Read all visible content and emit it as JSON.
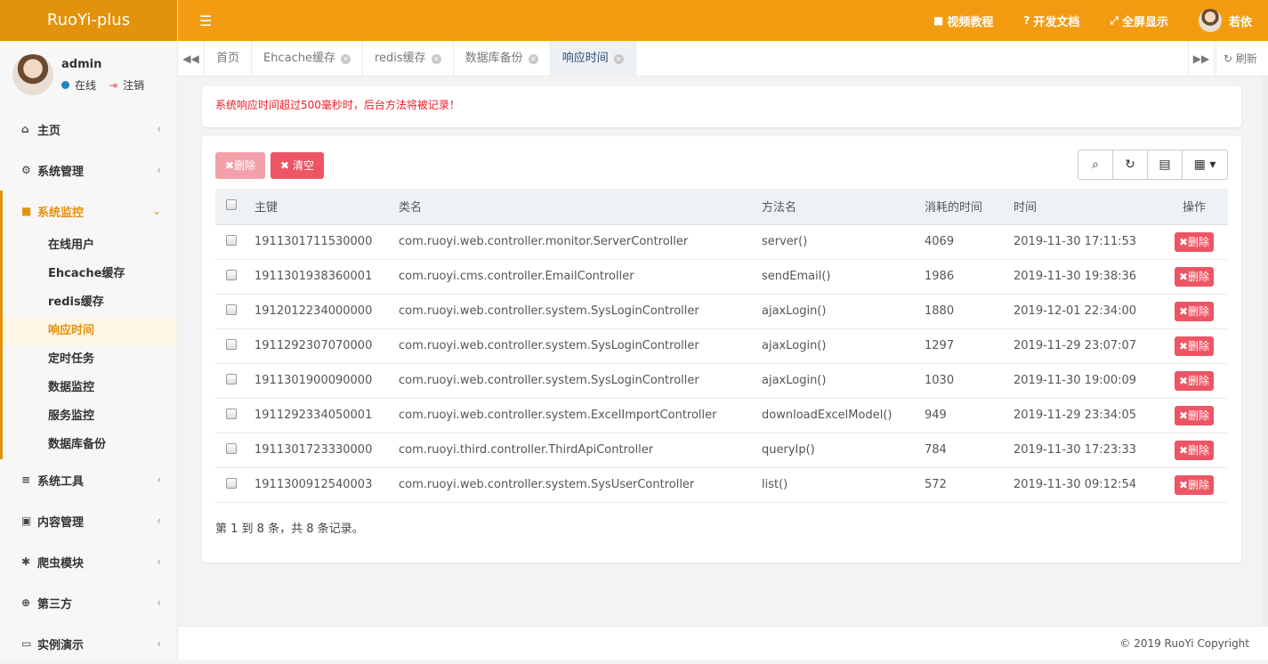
{
  "app": {
    "title": "RuoYi-plus"
  },
  "user": {
    "name": "admin",
    "status": "在线",
    "logout": "注销",
    "display_name": "若依"
  },
  "topbar": {
    "menu_icon": "bars-icon",
    "links": [
      {
        "label": "视频教程",
        "icon": "video-icon"
      },
      {
        "label": "开发文档",
        "icon": "question-icon"
      },
      {
        "label": "全屏显示",
        "icon": "fullscreen-icon"
      }
    ]
  },
  "sidebar": {
    "items": [
      {
        "label": "主页",
        "icon": "home-icon"
      },
      {
        "label": "系统管理",
        "icon": "gear-icon"
      },
      {
        "label": "系统监控",
        "icon": "video-icon",
        "open": true
      },
      {
        "label": "系统工具",
        "icon": "bars-icon"
      },
      {
        "label": "内容管理",
        "icon": "idcard-icon"
      },
      {
        "label": "爬虫模块",
        "icon": "bug-icon"
      },
      {
        "label": "第三方",
        "icon": "lifering-icon"
      },
      {
        "label": "实例演示",
        "icon": "desktop-icon"
      }
    ],
    "sub": [
      "在线用户",
      "Ehcache缓存",
      "redis缓存",
      "响应时间",
      "定时任务",
      "数据监控",
      "服务监控",
      "数据库备份"
    ],
    "active_sub": "响应时间"
  },
  "tabs": {
    "items": [
      "首页",
      "Ehcache缓存",
      "redis缓存",
      "数据库备份",
      "响应时间"
    ],
    "refresh": "刷新"
  },
  "notice": "系统响应时间超过500毫秒时，后台方法将被记录！",
  "toolbar": {
    "delete": "删除",
    "clear": "清空"
  },
  "table": {
    "headers": [
      "主键",
      "类名",
      "方法名",
      "消耗的时间",
      "时间",
      "操作"
    ],
    "rows": [
      [
        "1911301711530000",
        "com.ruoyi.web.controller.monitor.ServerController",
        "server()",
        "4069",
        "2019-11-30 17:11:53"
      ],
      [
        "1911301938360001",
        "com.ruoyi.cms.controller.EmailController",
        "sendEmail()",
        "1986",
        "2019-11-30 19:38:36"
      ],
      [
        "1912012234000000",
        "com.ruoyi.web.controller.system.SysLoginController",
        "ajaxLogin()",
        "1880",
        "2019-12-01 22:34:00"
      ],
      [
        "1911292307070000",
        "com.ruoyi.web.controller.system.SysLoginController",
        "ajaxLogin()",
        "1297",
        "2019-11-29 23:07:07"
      ],
      [
        "1911301900090000",
        "com.ruoyi.web.controller.system.SysLoginController",
        "ajaxLogin()",
        "1030",
        "2019-11-30 19:00:09"
      ],
      [
        "1911292334050001",
        "com.ruoyi.web.controller.system.ExcelImportController",
        "downloadExcelModel()",
        "949",
        "2019-11-29 23:34:05"
      ],
      [
        "1911301723330000",
        "com.ruoyi.third.controller.ThirdApiController",
        "queryIp()",
        "784",
        "2019-11-30 17:23:33"
      ],
      [
        "1911300912540003",
        "com.ruoyi.web.controller.system.SysUserController",
        "list()",
        "572",
        "2019-11-30 09:12:54"
      ]
    ],
    "row_action": "删除"
  },
  "pager": "第 1 到 8 条，共 8 条记录。",
  "footer": "© 2019 RuoYi Copyright"
}
